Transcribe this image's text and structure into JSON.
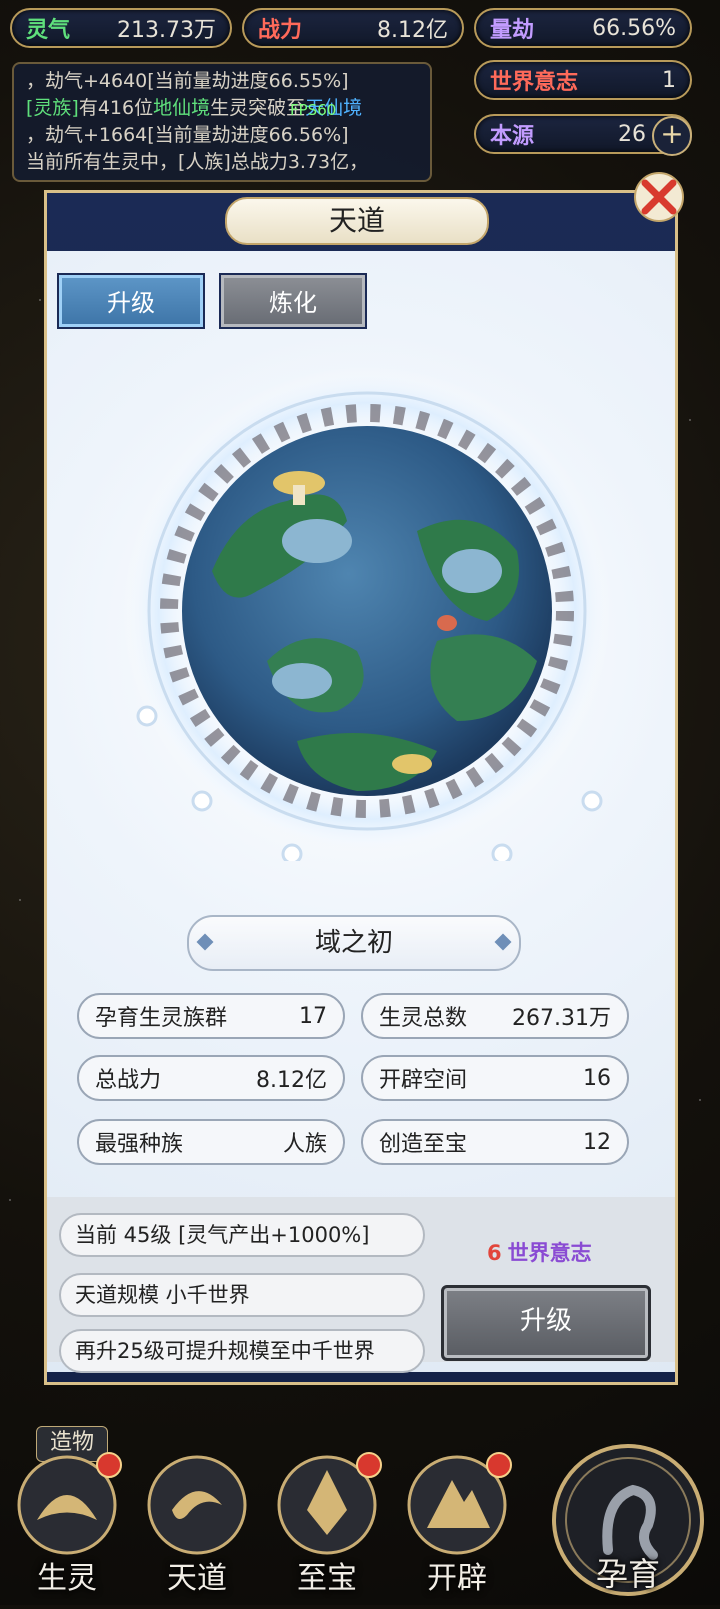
{
  "top_bar": {
    "lingqi": {
      "label": "灵气",
      "value": "213.73万"
    },
    "zhanli": {
      "label": "战力",
      "value": "8.12亿"
    },
    "liangjie": {
      "label": "量劫",
      "value": "66.56%"
    },
    "shijie": {
      "label": "世界意志",
      "value": "1"
    },
    "benyuan": {
      "label": "本源",
      "value": "26"
    }
  },
  "log": {
    "line1": "，劫气+4640[当前量劫进度66.55%]",
    "line2_a": "[灵族]",
    "line2_b": "有416位",
    "line2_c": "地仙境",
    "line2_d": "生灵突破至",
    "line2_e": "天仙境",
    "line3": "，劫气+1664[当前量劫进度66.56%]",
    "line4": "当前所有生灵中，[人族]总战力3.73亿，"
  },
  "fps": "FPS60",
  "dialog": {
    "title": "天道",
    "tabs": {
      "upgrade": "升级",
      "refine": "炼化"
    },
    "realm": "域之初",
    "stats": [
      {
        "label": "孕育生灵族群",
        "value": "17"
      },
      {
        "label": "生灵总数",
        "value": "267.31万"
      },
      {
        "label": "总战力",
        "value": "8.12亿"
      },
      {
        "label": "开辟空间",
        "value": "16"
      },
      {
        "label": "最强种族",
        "value": "人族"
      },
      {
        "label": "创造至宝",
        "value": "12"
      }
    ],
    "info": {
      "current": "当前  45级  [灵气产出+1000%]",
      "scale": "天道规模  小千世界",
      "next": "再升25级可提升规模至中千世界"
    },
    "cost": {
      "amount": "6",
      "unit": "世界意志"
    },
    "upgrade_button": "升级"
  },
  "side_label": "造物",
  "bottom_nav": [
    "生灵",
    "天道",
    "至宝",
    "开辟"
  ],
  "big_button": "孕育"
}
